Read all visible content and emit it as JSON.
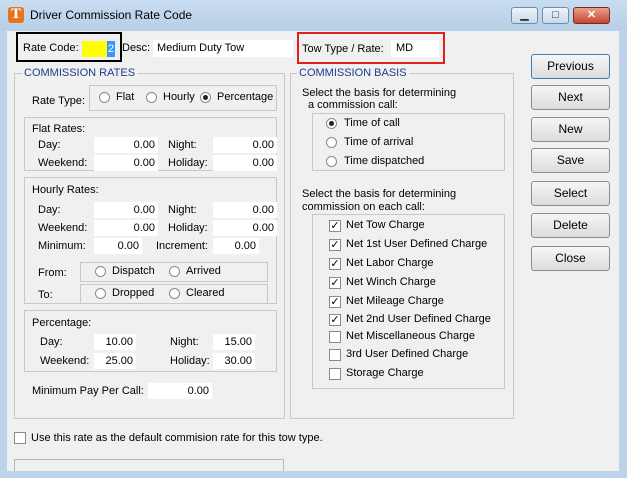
{
  "window": {
    "title": "Driver Commission Rate Code",
    "icon_letter": "T",
    "controls": {
      "minimize": "▁",
      "maximize": "□",
      "close": "✕"
    }
  },
  "header": {
    "rate_code_label": "Rate Code:",
    "rate_code_value": "2",
    "desc_label": "Desc:",
    "desc_value": "Medium Duty Tow",
    "tow_type_label": "Tow Type / Rate:",
    "tow_type_value": "MD"
  },
  "commission_rates": {
    "title": "COMMISSION RATES",
    "rate_type_label": "Rate Type:",
    "rate_type_options": [
      "Flat",
      "Hourly",
      "Percentage"
    ],
    "rate_type_selected": "Percentage",
    "flat": {
      "title": "Flat Rates:",
      "day_label": "Day:",
      "day": "0.00",
      "night_label": "Night:",
      "night": "0.00",
      "weekend_label": "Weekend:",
      "weekend": "0.00",
      "holiday_label": "Holiday:",
      "holiday": "0.00"
    },
    "hourly": {
      "title": "Hourly Rates:",
      "day_label": "Day:",
      "day": "0.00",
      "night_label": "Night:",
      "night": "0.00",
      "weekend_label": "Weekend:",
      "weekend": "0.00",
      "holiday_label": "Holiday:",
      "holiday": "0.00",
      "minimum_label": "Minimum:",
      "minimum": "0.00",
      "increment_label": "Increment:",
      "increment": "0.00",
      "from_label": "From:",
      "from_options": [
        "Dispatch",
        "Arrived"
      ],
      "to_label": "To:",
      "to_options": [
        "Dropped",
        "Cleared"
      ]
    },
    "percentage": {
      "title": "Percentage:",
      "day_label": "Day:",
      "day": "10.00",
      "night_label": "Night:",
      "night": "15.00",
      "weekend_label": "Weekend:",
      "weekend": "25.00",
      "holiday_label": "Holiday:",
      "holiday": "30.00"
    },
    "min_pay_label": "Minimum Pay Per Call:",
    "min_pay": "0.00"
  },
  "commission_basis": {
    "title": "COMMISSION BASIS",
    "basis_prompt_1": "Select the basis for determining",
    "basis_prompt_2": "a commission call:",
    "basis_options": [
      "Time of call",
      "Time of arrival",
      "Time dispatched"
    ],
    "basis_selected": "Time of call",
    "charges_prompt_1": "Select the basis for determining",
    "charges_prompt_2": "commission on each call:",
    "charges": [
      {
        "label": "Net Tow Charge",
        "checked": true
      },
      {
        "label": "Net 1st User Defined Charge",
        "checked": true
      },
      {
        "label": "Net Labor Charge",
        "checked": true
      },
      {
        "label": "Net Winch Charge",
        "checked": true
      },
      {
        "label": "Net Mileage Charge",
        "checked": true
      },
      {
        "label": "Net 2nd User Defined Charge",
        "checked": true
      },
      {
        "label": "Net Miscellaneous Charge",
        "checked": false
      },
      {
        "label": "3rd User Defined Charge",
        "checked": false
      },
      {
        "label": "Storage Charge",
        "checked": false
      }
    ]
  },
  "buttons": {
    "previous": "Previous",
    "next": "Next",
    "new": "New",
    "save": "Save",
    "select": "Select",
    "delete": "Delete",
    "close": "Close"
  },
  "footer": {
    "default_label": "Use this rate as the default commision rate for this tow type.",
    "default_checked": false
  }
}
